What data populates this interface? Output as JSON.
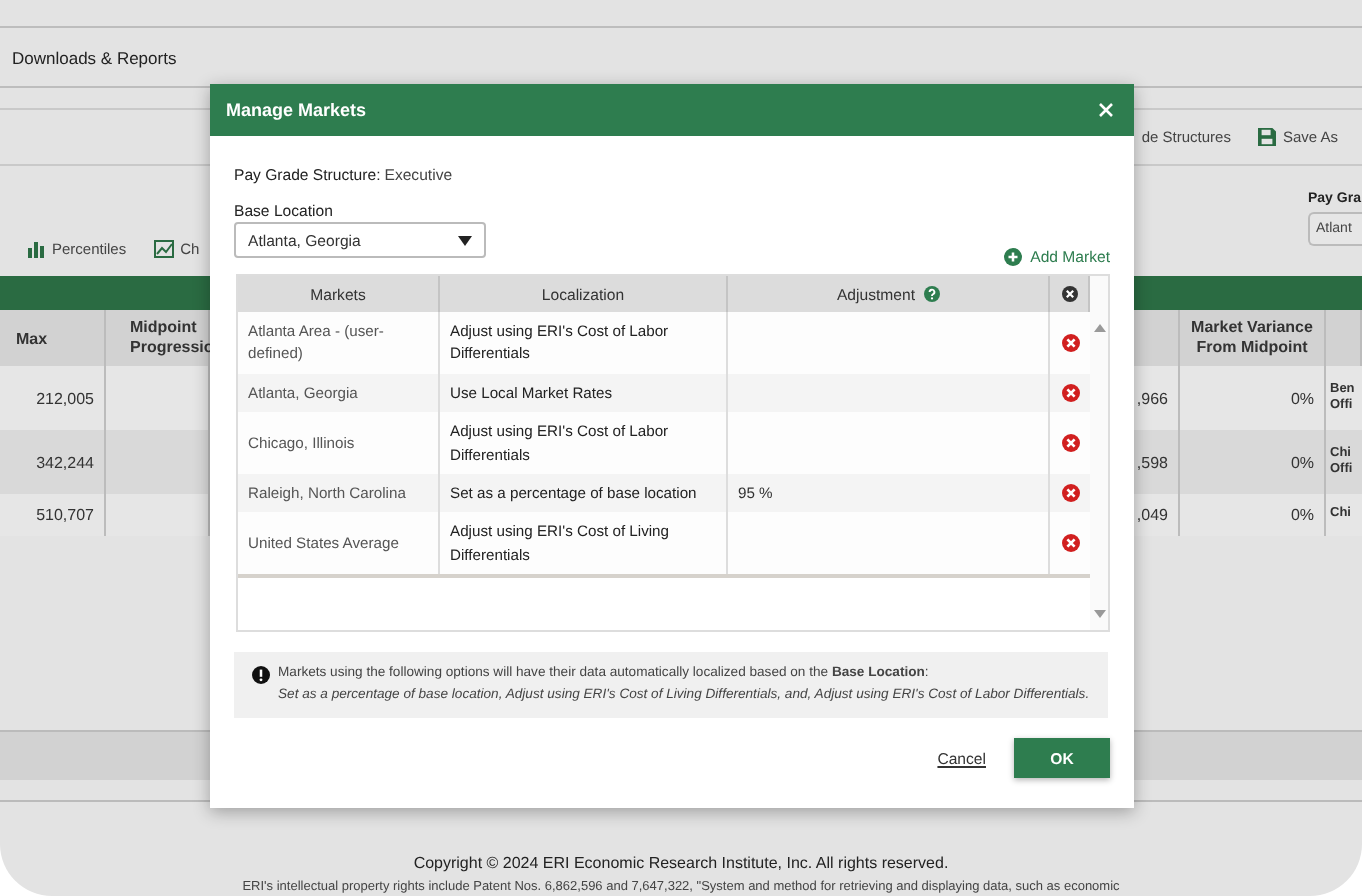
{
  "page": {
    "header_title": "Downloads & Reports",
    "toolbar": [
      {
        "kind": "text",
        "label": "de Structures"
      },
      {
        "kind": "save",
        "label": "Save As"
      }
    ],
    "views": [
      {
        "kind": "bars",
        "label": "Percentiles"
      },
      {
        "kind": "line",
        "label": "Ch"
      }
    ],
    "pay_grade_filter": {
      "label": "Pay Gra",
      "value": "Atlant"
    },
    "grid": {
      "columns": [
        "Max",
        "Midpoint Progressio",
        "Market Variance From Midpoint"
      ],
      "rows": [
        {
          "max": "212,005",
          "column_3": ",966",
          "variance": "0%",
          "column_5": [
            "Ben",
            "Offi"
          ]
        },
        {
          "max": "342,244",
          "column_3": ",598",
          "variance": "0%",
          "column_5": [
            "Chi",
            "Offi"
          ]
        },
        {
          "max": "510,707",
          "column_3": ",049",
          "variance": "0%",
          "column_5": [
            "Chi"
          ]
        }
      ]
    },
    "footer": {
      "copyright": "Copyright © 2024 ERI Economic Research Institute, Inc. All rights reserved.",
      "patents": "ERI's intellectual property rights include Patent Nos. 6,862,596 and 7,647,322, \"System and method for retrieving and displaying data, such as economic"
    }
  },
  "dialog": {
    "title": "Manage Markets",
    "structure_label": "Pay Grade Structure:",
    "structure_value": "Executive",
    "base_location": {
      "label": "Base Location",
      "value": "Atlanta, Georgia"
    },
    "add_market": "Add Market",
    "columns": [
      "Markets",
      "Localization",
      "Adjustment"
    ],
    "markets": [
      {
        "market": "Atlanta Area - (user-defined)",
        "localization": "Adjust using ERI's Cost of Labor Differentials"
      },
      {
        "market": "Atlanta, Georgia",
        "localization": "Use Local Market Rates"
      },
      {
        "market": "Chicago, Illinois",
        "localization": "Adjust using ERI's Cost of Labor Differentials"
      },
      {
        "market": "Raleigh, North Carolina",
        "localization": "Set as a percentage of base location",
        "adjustment": "95 %"
      },
      {
        "market": "United States Average",
        "localization": "Adjust using ERI's Cost of Living Differentials"
      }
    ],
    "note": "Markets using the following options will have their data automatically localized based on the **Base Location**:",
    "note_detail": "Set as a percentage of base location, Adjust using ERI's Cost of Living Differentials, and, Adjust using ERI's Cost of Labor Differentials.",
    "buttons": [
      {
        "kind": "link",
        "label": "Cancel"
      },
      {
        "kind": "primary",
        "label": "OK"
      }
    ]
  }
}
